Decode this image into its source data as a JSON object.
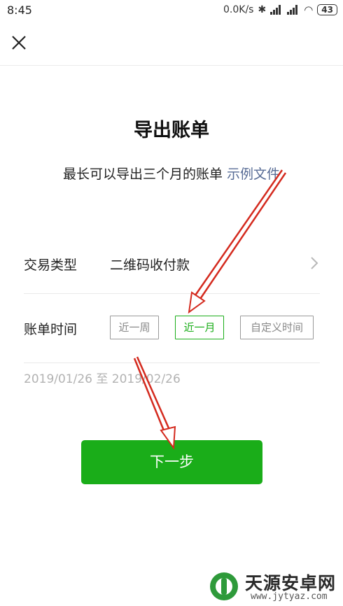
{
  "status_bar": {
    "time": "8:45",
    "net_speed": "0.0K/s",
    "bluetooth": "✱",
    "battery": "43"
  },
  "header": {
    "close_icon": "close-icon"
  },
  "page": {
    "title": "导出账单",
    "subtitle": "最长可以导出三个月的账单",
    "sample_link": "示例文件"
  },
  "form": {
    "type_label": "交易类型",
    "type_value": "二维码收付款",
    "time_label": "账单时间",
    "chips": [
      "近一周",
      "近一月",
      "自定义时间"
    ],
    "selected_chip": "近一月",
    "date_range": "2019/01/26 至 2019/02/26"
  },
  "actions": {
    "next_label": "下一步"
  },
  "watermark": {
    "title": "天源安卓网",
    "url": "www.jytyaz.com"
  },
  "colors": {
    "accent": "#1aad19",
    "link": "#576b95",
    "annotation": "#d42a1e"
  }
}
